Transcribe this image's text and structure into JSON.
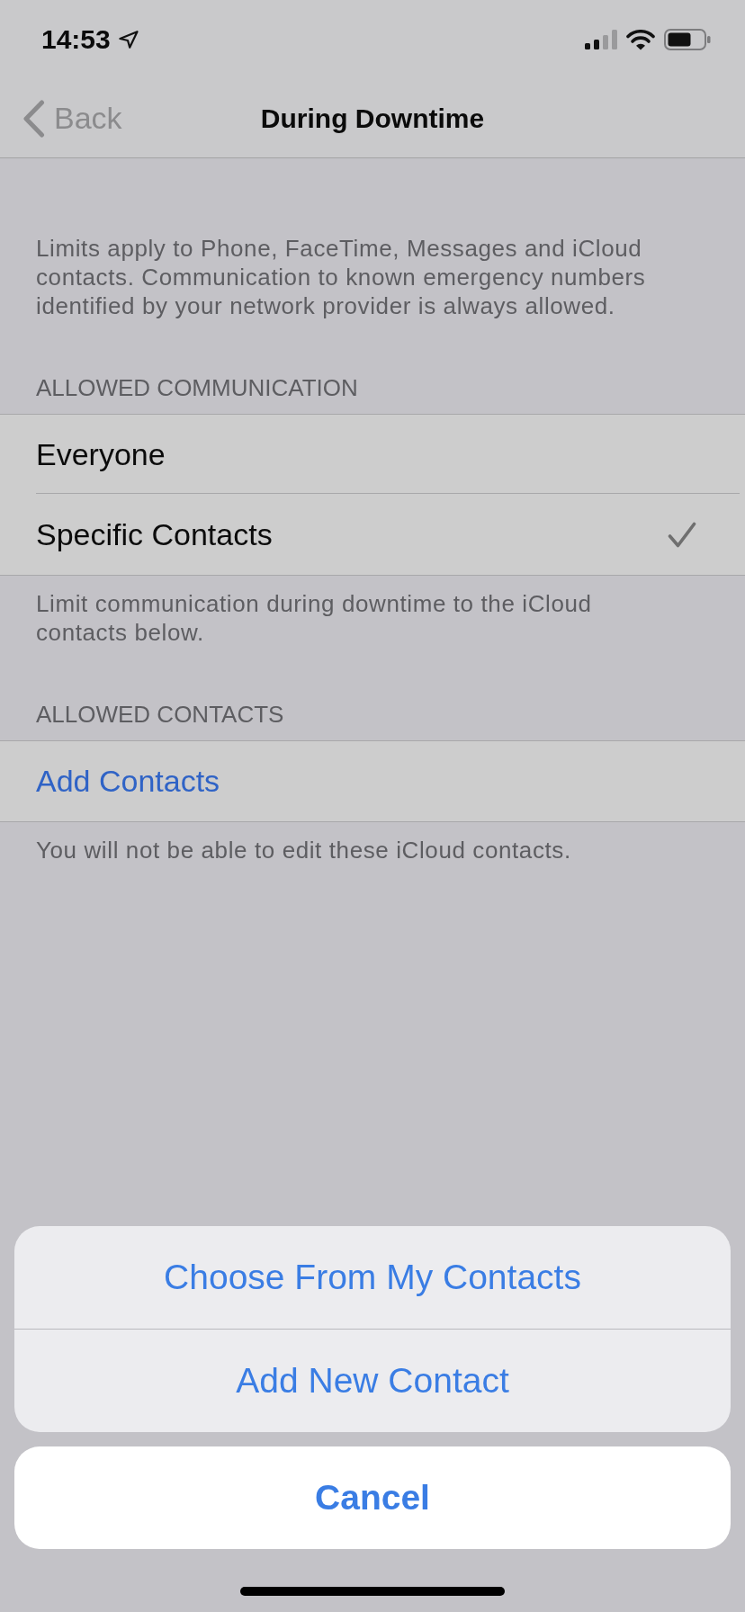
{
  "status_bar": {
    "time": "14:53"
  },
  "nav_bar": {
    "back": "Back",
    "title": "During Downtime"
  },
  "intro_note": "Limits apply to Phone, FaceTime, Messages and iCloud contacts. Communication to known emergency numbers identified by your network provider is always allowed.",
  "sections": [
    {
      "header": "ALLOWED COMMUNICATION",
      "rows": [
        {
          "kind": "option",
          "label": "Everyone",
          "selected": false
        },
        {
          "kind": "option",
          "label": "Specific Contacts",
          "selected": true
        }
      ],
      "footer": "Limit communication during downtime to the iCloud contacts below."
    },
    {
      "header": "ALLOWED CONTACTS",
      "rows": [
        {
          "kind": "action",
          "label": "Add Contacts"
        }
      ],
      "footer": "You will not be able to edit these iCloud contacts."
    }
  ],
  "action_sheet": {
    "actions": [
      "Choose From My Contacts",
      "Add New Contact"
    ],
    "cancel": "Cancel"
  }
}
